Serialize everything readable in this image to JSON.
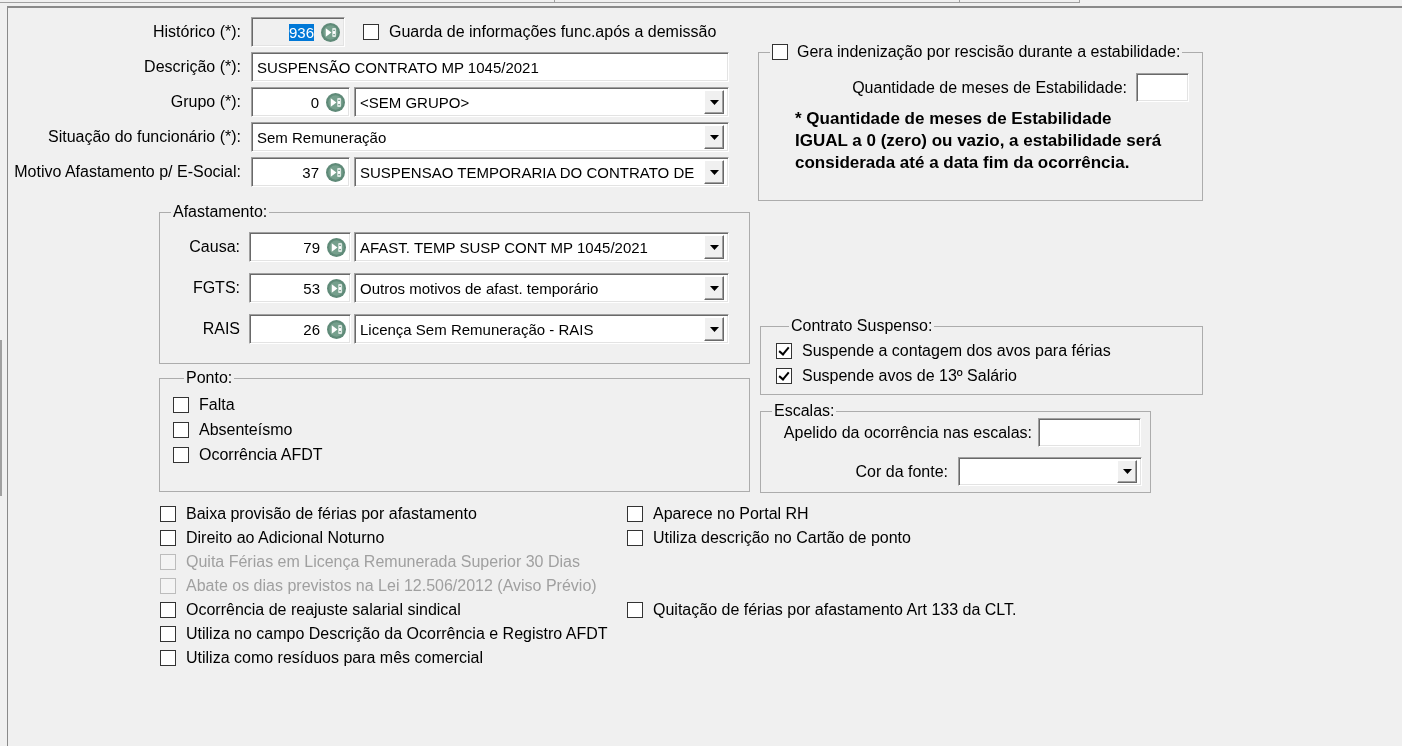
{
  "main_fields": [
    {
      "kind": "code_check",
      "label": "Histórico (*):",
      "code": "936",
      "readonly": true,
      "highlighted": true,
      "checkbox": {
        "label": "Guarda de informações func.após a demissão",
        "checked": false
      }
    },
    {
      "kind": "text",
      "label": "Descrição (*):",
      "value": "SUSPENSÃO CONTRATO MP 1045/2021",
      "readonly": false,
      "highlighted": false
    },
    {
      "kind": "code_select",
      "label": "Grupo (*):",
      "code": "0",
      "value": "<SEM GRUPO>",
      "readonly": false,
      "highlighted": false
    },
    {
      "kind": "select",
      "label": "Situação do funcionário (*):",
      "value": "Sem Remuneração",
      "readonly": false,
      "highlighted": false
    },
    {
      "kind": "code_select",
      "label": "Motivo Afastamento p/ E-Social:",
      "code": "37",
      "value": "SUSPENSAO TEMPORARIA DO CONTRATO DE",
      "readonly": false,
      "highlighted": false
    }
  ],
  "afastamento": {
    "title": "Afastamento:",
    "rows": [
      {
        "label": "Causa:",
        "code": "79",
        "value": "AFAST. TEMP SUSP CONT MP 1045/2021"
      },
      {
        "label": "FGTS:",
        "code": "53",
        "value": "Outros motivos de afast. temporário"
      },
      {
        "label": "RAIS",
        "code": "26",
        "value": "Licença Sem Remuneração - RAIS"
      }
    ]
  },
  "ponto": {
    "title": "Ponto:",
    "options": [
      {
        "label": "Falta",
        "checked": false
      },
      {
        "label": "Absenteísmo",
        "checked": false
      },
      {
        "label": "Ocorrência AFDT",
        "checked": false
      }
    ]
  },
  "estabilidade": {
    "checkbox": {
      "label": "Gera indenização por rescisão durante a estabilidade:",
      "checked": false
    },
    "months_label": "Quantidade de meses de Estabilidade:",
    "note": "* Quantidade de meses de Estabilidade\nIGUAL a 0 (zero) ou vazio, a estabilidade será\nconsiderada até a data fim da ocorrência."
  },
  "contrato_suspenso": {
    "title": "Contrato Suspenso:",
    "options": [
      {
        "label": "Suspende a contagem dos avos para férias",
        "checked": true
      },
      {
        "label": "Suspende avos de 13º Salário",
        "checked": true
      }
    ]
  },
  "escalas": {
    "title": "Escalas:",
    "nickname_label": "Apelido da ocorrência nas escalas:",
    "font_color_label": "Cor da fonte:"
  },
  "options": [
    {
      "left": {
        "label": "Baixa provisão de férias por afastamento",
        "checked": false,
        "disabled": false
      },
      "right": {
        "label": "Aparece no Portal RH",
        "checked": false,
        "disabled": false
      }
    },
    {
      "left": {
        "label": "Direito ao Adicional Noturno",
        "checked": false,
        "disabled": false
      },
      "right": {
        "label": "Utiliza descrição no Cartão de ponto",
        "checked": false,
        "disabled": false
      }
    },
    {
      "left": {
        "label": "Quita Férias em Licença Remunerada Superior 30 Dias",
        "checked": false,
        "disabled": true
      }
    },
    {
      "left": {
        "label": "Abate os dias previstos na Lei 12.506/2012 (Aviso Prévio)",
        "checked": false,
        "disabled": true
      }
    },
    {
      "left": {
        "label": "Ocorrência de reajuste salarial sindical",
        "checked": false,
        "disabled": false
      },
      "right": {
        "label": "Quitação de férias por afastamento Art 133 da CLT.",
        "checked": false,
        "disabled": false
      }
    },
    {
      "left": {
        "label": "Utiliza no campo Descrição da Ocorrência e Registro AFDT",
        "checked": false,
        "disabled": false
      }
    },
    {
      "left": {
        "label": "Utiliza como resíduos para mês comercial",
        "checked": false,
        "disabled": false
      }
    }
  ]
}
